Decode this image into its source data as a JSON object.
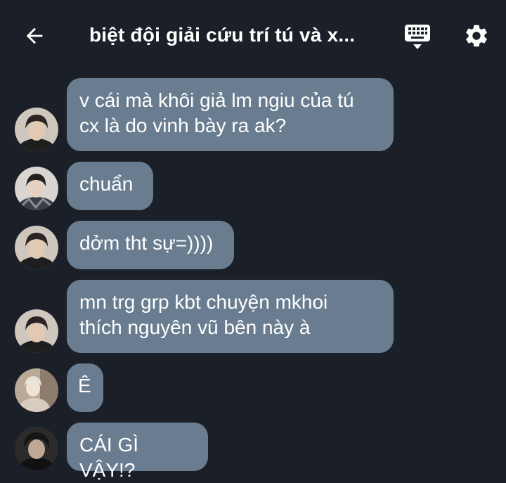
{
  "header": {
    "title": "biệt đội giải cứu trí tú và x...",
    "back_icon": "arrow-left-icon",
    "keyboard_icon": "keyboard-icon",
    "settings_icon": "gear-icon"
  },
  "colors": {
    "background": "#1b2028",
    "bubble": "#6a7d90",
    "text": "#ffffff"
  },
  "messages": [
    {
      "text": "v cái mà khôi giả lm ngiu của tú\ncx là do vinh bày ra ak?"
    },
    {
      "text": "chuẩn"
    },
    {
      "text": "dởm tht sự=))))"
    },
    {
      "text": "mn trg grp kbt chuyện mkhoi\nthích nguyên vũ bên này à"
    },
    {
      "text": "Ê"
    },
    {
      "text": "CÁI GÌ VẬY!?"
    }
  ]
}
